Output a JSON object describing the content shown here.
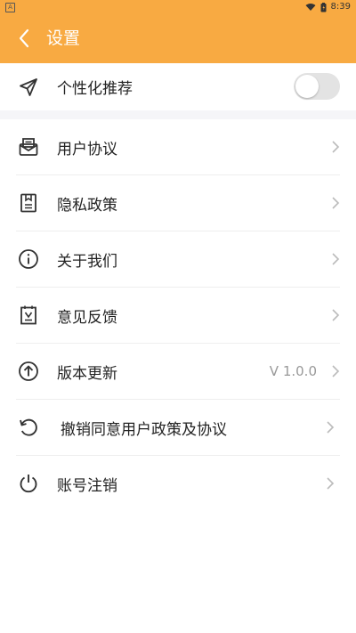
{
  "status_bar": {
    "left_badge": "A",
    "time": "8:39",
    "icons": [
      "wifi-icon",
      "battery-icon"
    ]
  },
  "app_bar": {
    "back_icon": "chevron-left-icon",
    "title": "设置"
  },
  "personalize": {
    "icon": "paper-plane-icon",
    "label": "个性化推荐",
    "enabled": false
  },
  "menu": {
    "items": [
      {
        "icon": "envelope-icon",
        "label": "用户协议",
        "value": ""
      },
      {
        "icon": "document-icon",
        "label": "隐私政策",
        "value": ""
      },
      {
        "icon": "info-icon",
        "label": "关于我们",
        "value": ""
      },
      {
        "icon": "feedback-icon",
        "label": "意见反馈",
        "value": ""
      },
      {
        "icon": "upload-circle-icon",
        "label": "版本更新",
        "value": "V 1.0.0"
      },
      {
        "icon": "revoke-icon",
        "label": "撤销同意用户政策及协议",
        "value": ""
      },
      {
        "icon": "power-icon",
        "label": "账号注销",
        "value": ""
      }
    ]
  },
  "colors": {
    "accent": "#f8aa42",
    "toggle_off": "#e3e3e3",
    "chevron": "#bbbbbb"
  }
}
